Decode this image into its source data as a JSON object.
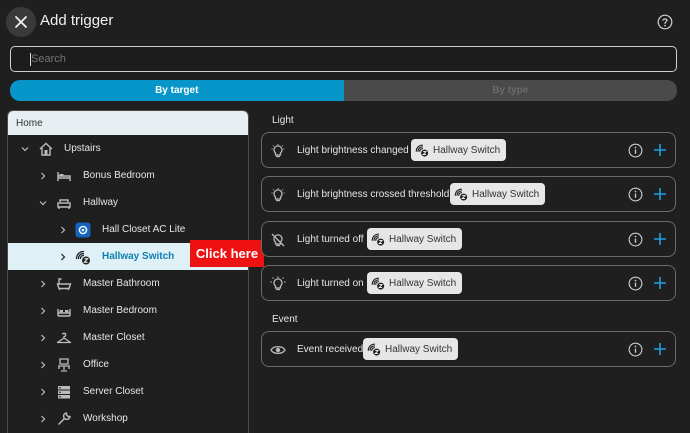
{
  "dialog": {
    "title": "Add trigger"
  },
  "search": {
    "placeholder": "Search"
  },
  "tabs": [
    {
      "label": "By target",
      "active": true
    },
    {
      "label": "By type",
      "active": false
    }
  ],
  "tree": {
    "home_label": "Home",
    "items": [
      {
        "label": "Upstairs",
        "icon": "home-floor-icon"
      },
      {
        "label": "Bonus Bedroom",
        "icon": "bed-icon"
      },
      {
        "label": "Hallway",
        "icon": "sofa-icon"
      },
      {
        "label": "Hall Closet AC Lite",
        "icon": "device-icon"
      },
      {
        "label": "Hallway Switch",
        "icon": "zwave-icon"
      },
      {
        "label": "Master Bathroom",
        "icon": "bathtub-icon"
      },
      {
        "label": "Master Bedroom",
        "icon": "bed-icon"
      },
      {
        "label": "Master Closet",
        "icon": "hanger-icon"
      },
      {
        "label": "Office",
        "icon": "desk-icon"
      },
      {
        "label": "Server Closet",
        "icon": "server-icon"
      },
      {
        "label": "Workshop",
        "icon": "tools-icon"
      }
    ]
  },
  "callout": {
    "text": "Click here"
  },
  "sections": {
    "light": {
      "label": "Light",
      "triggers": [
        {
          "text": "Light brightness changed",
          "chip": "Hallway Switch",
          "icon": "lightbulb-icon"
        },
        {
          "text": "Light brightness crossed threshold",
          "chip": "Hallway Switch",
          "icon": "lightbulb-icon"
        },
        {
          "text": "Light turned off",
          "chip": "Hallway Switch",
          "icon": "lightbulb-off-icon"
        },
        {
          "text": "Light turned on",
          "chip": "Hallway Switch",
          "icon": "lightbulb-on-icon"
        }
      ]
    },
    "event": {
      "label": "Event",
      "triggers": [
        {
          "text": "Event received",
          "chip": "Hallway Switch",
          "icon": "eye-icon"
        }
      ]
    }
  },
  "colors": {
    "accent": "#0796c9",
    "selected_bg": "#e0f0f7",
    "callout": "#ee1111"
  }
}
